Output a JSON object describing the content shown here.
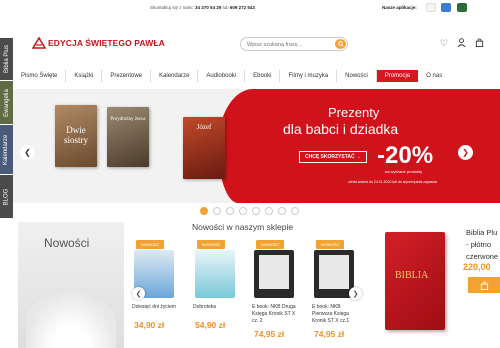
{
  "side_tabs": [
    "Biblia Plus",
    "Ewangelia",
    "Kalendarze",
    "BLOG"
  ],
  "topbar": {
    "contact_prefix": "Skontaktuj się z nami:",
    "phone1": "34 370 54 29",
    "or": "lub",
    "phone2": "609 272 543",
    "apps_label": "Nasze aplikacje:"
  },
  "header": {
    "logo_text": "EDYCJA ŚWIĘTEGO PAWŁA",
    "search_placeholder": "Wpisz szukaną frazę..."
  },
  "nav": {
    "items": [
      "Pismo Święte",
      "Książki",
      "Prezentowe",
      "Kalendarze",
      "Audiobooki",
      "Ebooki",
      "Filmy i muzyka",
      "Nowości",
      "Promocje",
      "O nas"
    ],
    "active": "Promocje"
  },
  "banner": {
    "line1": "Prezenty",
    "line2": "dla babci i dziadka",
    "cta": "CHCĘ SKORZYSTAĆ →",
    "discount": "-20%",
    "discount_sub": "na wybrane produkty",
    "fine_print": "oferta ważna do 24.01.2020 lub do wyczerpania zapasów",
    "books": [
      "Dwie siostry",
      "Przydrożny Jezus",
      "Józef"
    ]
  },
  "carousel": {
    "dots": 8,
    "active_index": 0
  },
  "new_products": {
    "title": "Nowości w naszym sklepie",
    "panel_label": "Nowości",
    "products": [
      {
        "badge": "NOWOŚĆ",
        "name": "Dziesięć dni życiem",
        "price": "34,90 zł"
      },
      {
        "badge": "NOWOŚĆ",
        "name": "Dobroteka",
        "price": "54,90 zł"
      },
      {
        "badge": "NOWOŚĆ",
        "name": "E book: NKB Druga Księga Kronik ST X cz. 2",
        "price": "74,95 zł"
      },
      {
        "badge": "NOWOŚĆ",
        "name": "E book: NKB Pierwsza Księga Kronik ST X cz.1",
        "price": "74,95 zł"
      }
    ]
  },
  "featured": {
    "book_title": "BIBLIA",
    "name_line1": "Biblia Plu",
    "name_line2": "- płótno",
    "name_line3": "czerwone",
    "price": "220,00"
  }
}
